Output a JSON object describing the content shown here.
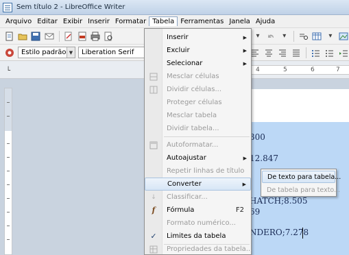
{
  "window": {
    "title": "Sem título 2 - LibreOffice Writer"
  },
  "menubar": [
    {
      "label": "Arquivo"
    },
    {
      "label": "Editar"
    },
    {
      "label": "Exibir"
    },
    {
      "label": "Inserir"
    },
    {
      "label": "Formatar"
    },
    {
      "label": "Tabela"
    },
    {
      "label": "Ferramentas"
    },
    {
      "label": "Janela"
    },
    {
      "label": "Ajuda"
    }
  ],
  "toolbar2": {
    "style_value": "Estilo padrão",
    "font_value": "Liberation Serif"
  },
  "ruler": {
    "numbers": [
      "4",
      "5",
      "6",
      "7"
    ]
  },
  "document": {
    "lines": [
      "300",
      "12.847",
      "HATCH;8.505",
      "69",
      "NDERO;7.278"
    ]
  },
  "table_menu": {
    "items": [
      {
        "label": "Inserir",
        "enabled": true,
        "submenu": true
      },
      {
        "label": "Excluir",
        "enabled": true,
        "submenu": true
      },
      {
        "label": "Selecionar",
        "enabled": true,
        "submenu": true
      },
      {
        "label": "Mesclar células",
        "enabled": false,
        "icon": "merge-cells-icon"
      },
      {
        "label": "Dividir células...",
        "enabled": false,
        "icon": "split-cells-icon"
      },
      {
        "label": "Proteger células",
        "enabled": false
      },
      {
        "label": "Mesclar tabela",
        "enabled": false
      },
      {
        "label": "Dividir tabela...",
        "enabled": false
      },
      {
        "label": "Autoformatar...",
        "enabled": false,
        "icon": "autoformat-icon"
      },
      {
        "label": "Autoajustar",
        "enabled": true,
        "submenu": true
      },
      {
        "label": "Repetir linhas de título",
        "enabled": false
      },
      {
        "label": "Converter",
        "enabled": true,
        "submenu": true,
        "highlighted": true
      },
      {
        "label": "Classificar...",
        "enabled": false,
        "icon": "sort-icon"
      },
      {
        "label": "Fórmula",
        "enabled": true,
        "shortcut": "F2",
        "icon": "formula-icon"
      },
      {
        "label": "Formato numérico...",
        "enabled": false
      },
      {
        "label": "Limites da tabela",
        "enabled": true,
        "checked": true,
        "icon": "checkmark-icon"
      },
      {
        "label": "Propriedades da tabela...",
        "enabled": false,
        "icon": "table-properties-icon"
      }
    ]
  },
  "converter_submenu": {
    "items": [
      {
        "label": "De texto para tabela...",
        "enabled": true,
        "highlighted": true
      },
      {
        "label": "De tabela para texto...",
        "enabled": false
      }
    ]
  },
  "colors": {
    "selection": "#bcd8f6",
    "highlight_border": "#a8c3e0"
  }
}
